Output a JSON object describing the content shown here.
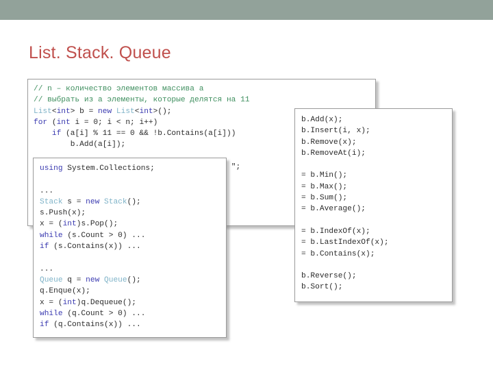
{
  "theme": {
    "band_color": "#92a29a",
    "title_color": "#c0504d",
    "page_background": "#ffffff",
    "box_border_color": "#9a9a9a",
    "comment_color": "#3f8f5f",
    "keyword_color": "#3a3ab0",
    "type_color": "#7fb3c8",
    "text_color": "#2b2b2b"
  },
  "slide": {
    "title": "List. Stack. Queue"
  },
  "code_boxes": {
    "list_example": {
      "name": "List example",
      "lines": [
        "// n – количество элементов массива a",
        "// выбрать из a элементы, которые делятся на 11",
        "List<int> b = new List<int>();",
        "for (int i = 0; i < n; i++)",
        "    if (a[i] % 11 == 0 && !b.Contains(a[i]))",
        "        b.Add(a[i]);",
        "",
        "string s = \";",
        ""
      ]
    },
    "stack_queue_example": {
      "name": "Stack and Queue example",
      "lines": [
        "using System.Collections;",
        "",
        "...",
        "Stack s = new Stack();",
        "s.Push(x);",
        "x = (int)s.Pop();",
        "while (s.Count > 0) ...",
        "if (s.Contains(x)) ...",
        "",
        "...",
        "Queue q = new Queue();",
        "q.Enque(x);",
        "x = (int)q.Dequeue();",
        "while (q.Count > 0) ...",
        "if (q.Contains(x)) ..."
      ]
    },
    "list_members": {
      "name": "List members",
      "lines": [
        "b.Add(x);",
        "b.Insert(i, x);",
        "b.Remove(x);",
        "b.RemoveAt(i);",
        "",
        "= b.Min();",
        "= b.Max();",
        "= b.Sum();",
        "= b.Average();",
        "",
        "= b.IndexOf(x);",
        "= b.LastIndexOf(x);",
        "= b.Contains(x);",
        "",
        "b.Reverse();",
        "b.Sort();"
      ]
    }
  }
}
